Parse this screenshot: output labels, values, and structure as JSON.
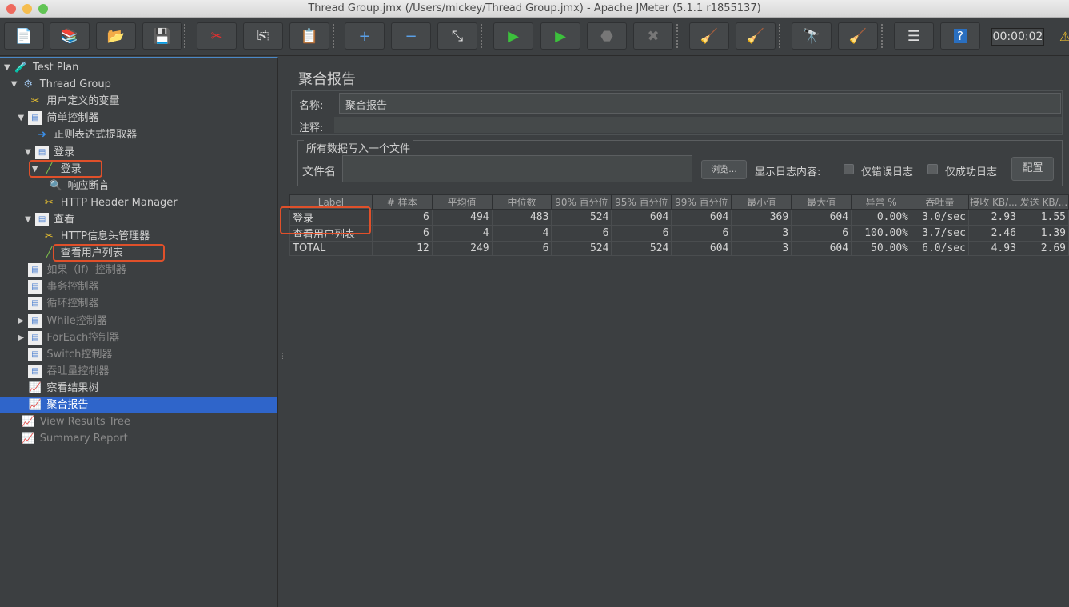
{
  "window": {
    "title": "Thread Group.jmx (/Users/mickey/Thread Group.jmx) - Apache JMeter (5.1.1 r1855137)"
  },
  "toolbar": {
    "buttons": [
      {
        "name": "new-icon",
        "glyph": "📄"
      },
      {
        "name": "templates-icon",
        "glyph": "📚"
      },
      {
        "name": "open-icon",
        "glyph": "📂"
      },
      {
        "name": "save-icon",
        "glyph": "💾"
      },
      {
        "name": "cut-icon",
        "glyph": "✂"
      },
      {
        "name": "copy-icon",
        "glyph": "⎘"
      },
      {
        "name": "paste-icon",
        "glyph": "📋"
      },
      {
        "name": "expand-icon",
        "glyph": "+"
      },
      {
        "name": "collapse-icon",
        "glyph": "−"
      },
      {
        "name": "toggle-icon",
        "glyph": "⤡"
      },
      {
        "name": "start-icon",
        "glyph": "▶"
      },
      {
        "name": "start-no-pause-icon",
        "glyph": "▶"
      },
      {
        "name": "stop-icon",
        "glyph": "⬣"
      },
      {
        "name": "shutdown-icon",
        "glyph": "✖"
      },
      {
        "name": "clear-icon",
        "glyph": "🧹"
      },
      {
        "name": "clear-all-icon",
        "glyph": "🧹"
      },
      {
        "name": "search-icon",
        "glyph": "🔭"
      },
      {
        "name": "reset-search-icon",
        "glyph": "🧹"
      },
      {
        "name": "function-helper-icon",
        "glyph": "☰"
      },
      {
        "name": "help-icon",
        "glyph": "?"
      }
    ],
    "timer": "00:00:02",
    "warning_icon": "⚠"
  },
  "tree": {
    "items": [
      {
        "label": "Test Plan",
        "arrow": "expanded",
        "icon": "test-plan-icon",
        "glyph": "🧪",
        "depth": 0,
        "state": "normal"
      },
      {
        "label": "Thread Group",
        "arrow": "expanded",
        "icon": "gear-icon",
        "glyph": "⚙",
        "depth": 1,
        "state": "normal"
      },
      {
        "label": "用户定义的变量",
        "arrow": "",
        "icon": "config-wrench-icon",
        "glyph": "✂",
        "depth": 2,
        "state": "normal"
      },
      {
        "label": "简单控制器",
        "arrow": "expanded",
        "icon": "controller-icon",
        "glyph": "▤",
        "depth": 2,
        "state": "normal"
      },
      {
        "label": "正则表达式提取器",
        "arrow": "",
        "icon": "post-processor-icon",
        "glyph": "➜",
        "depth": 3,
        "state": "normal"
      },
      {
        "label": "登录",
        "arrow": "expanded",
        "icon": "controller-icon",
        "glyph": "▤",
        "depth": 3,
        "state": "normal"
      },
      {
        "label": "登录",
        "arrow": "expanded",
        "icon": "sampler-pipette-icon",
        "glyph": "╱",
        "depth": 4,
        "state": "highlighted"
      },
      {
        "label": "响应断言",
        "arrow": "",
        "icon": "assertion-magnifier-icon",
        "glyph": "🔍",
        "depth": 5,
        "state": "normal"
      },
      {
        "label": "HTTP Header Manager",
        "arrow": "",
        "icon": "config-wrench-icon",
        "glyph": "✂",
        "depth": 4,
        "state": "normal"
      },
      {
        "label": "查看",
        "arrow": "expanded",
        "icon": "controller-icon",
        "glyph": "▤",
        "depth": 3,
        "state": "normal"
      },
      {
        "label": "HTTP信息头管理器",
        "arrow": "",
        "icon": "config-wrench-icon",
        "glyph": "✂",
        "depth": 4,
        "state": "normal"
      },
      {
        "label": "查看用户列表",
        "arrow": "",
        "icon": "sampler-pipette-icon",
        "glyph": "╱",
        "depth": 4,
        "state": "highlighted"
      },
      {
        "label": "如果（If）控制器",
        "arrow": "",
        "icon": "controller-icon",
        "glyph": "▤",
        "depth": 2,
        "state": "disabled"
      },
      {
        "label": "事务控制器",
        "arrow": "",
        "icon": "controller-icon",
        "glyph": "▤",
        "depth": 2,
        "state": "disabled"
      },
      {
        "label": "循环控制器",
        "arrow": "",
        "icon": "controller-icon",
        "glyph": "▤",
        "depth": 2,
        "state": "disabled"
      },
      {
        "label": "While控制器",
        "arrow": "collapsed",
        "icon": "controller-icon",
        "glyph": "▤",
        "depth": 2,
        "state": "disabled"
      },
      {
        "label": "ForEach控制器",
        "arrow": "collapsed",
        "icon": "controller-icon",
        "glyph": "▤",
        "depth": 2,
        "state": "disabled"
      },
      {
        "label": "Switch控制器",
        "arrow": "",
        "icon": "controller-icon",
        "glyph": "▤",
        "depth": 2,
        "state": "disabled"
      },
      {
        "label": "吞吐量控制器",
        "arrow": "",
        "icon": "controller-icon",
        "glyph": "▤",
        "depth": 2,
        "state": "disabled"
      },
      {
        "label": "察看结果树",
        "arrow": "",
        "icon": "listener-chart-icon",
        "glyph": "📈",
        "depth": 2,
        "state": "normal"
      },
      {
        "label": "聚合报告",
        "arrow": "",
        "icon": "listener-chart-icon",
        "glyph": "📈",
        "depth": 2,
        "state": "selected"
      },
      {
        "label": "View Results Tree",
        "arrow": "",
        "icon": "listener-chart-icon",
        "glyph": "📈",
        "depth": 1,
        "state": "disabled"
      },
      {
        "label": "Summary Report",
        "arrow": "",
        "icon": "listener-chart-icon",
        "glyph": "📈",
        "depth": 1,
        "state": "disabled"
      }
    ]
  },
  "panel": {
    "title": "聚合报告",
    "name_label": "名称:",
    "name_value": "聚合报告",
    "comment_label": "注释:",
    "comment_value": "",
    "file_group_title": "所有数据写入一个文件",
    "filename_label": "文件名",
    "filename_value": "",
    "browse_button": "浏览...",
    "log_label": "显示日志内容:",
    "errors_only": {
      "label": "仅错误日志",
      "checked": false
    },
    "success_only": {
      "label": "仅成功日志",
      "checked": false
    },
    "configure_button": "配置"
  },
  "table": {
    "columns": [
      "Label",
      "# 样本",
      "平均值",
      "中位数",
      "90% 百分位",
      "95% 百分位",
      "99% 百分位",
      "最小值",
      "最大值",
      "异常 %",
      "吞吐量",
      "接收 KB/...",
      "发送 KB/..."
    ],
    "rows": [
      [
        "登录",
        "6",
        "494",
        "483",
        "524",
        "604",
        "604",
        "369",
        "604",
        "0.00%",
        "3.0/sec",
        "2.93",
        "1.55"
      ],
      [
        "查看用户列表",
        "6",
        "4",
        "4",
        "6",
        "6",
        "6",
        "3",
        "6",
        "100.00%",
        "3.7/sec",
        "2.46",
        "1.39"
      ],
      [
        "TOTAL",
        "12",
        "249",
        "6",
        "524",
        "524",
        "604",
        "3",
        "604",
        "50.00%",
        "6.0/sec",
        "4.93",
        "2.69"
      ]
    ]
  },
  "colors": {
    "background": "#3c3f41",
    "selection": "#2f65ca",
    "highlight_box": "#e0502a"
  }
}
